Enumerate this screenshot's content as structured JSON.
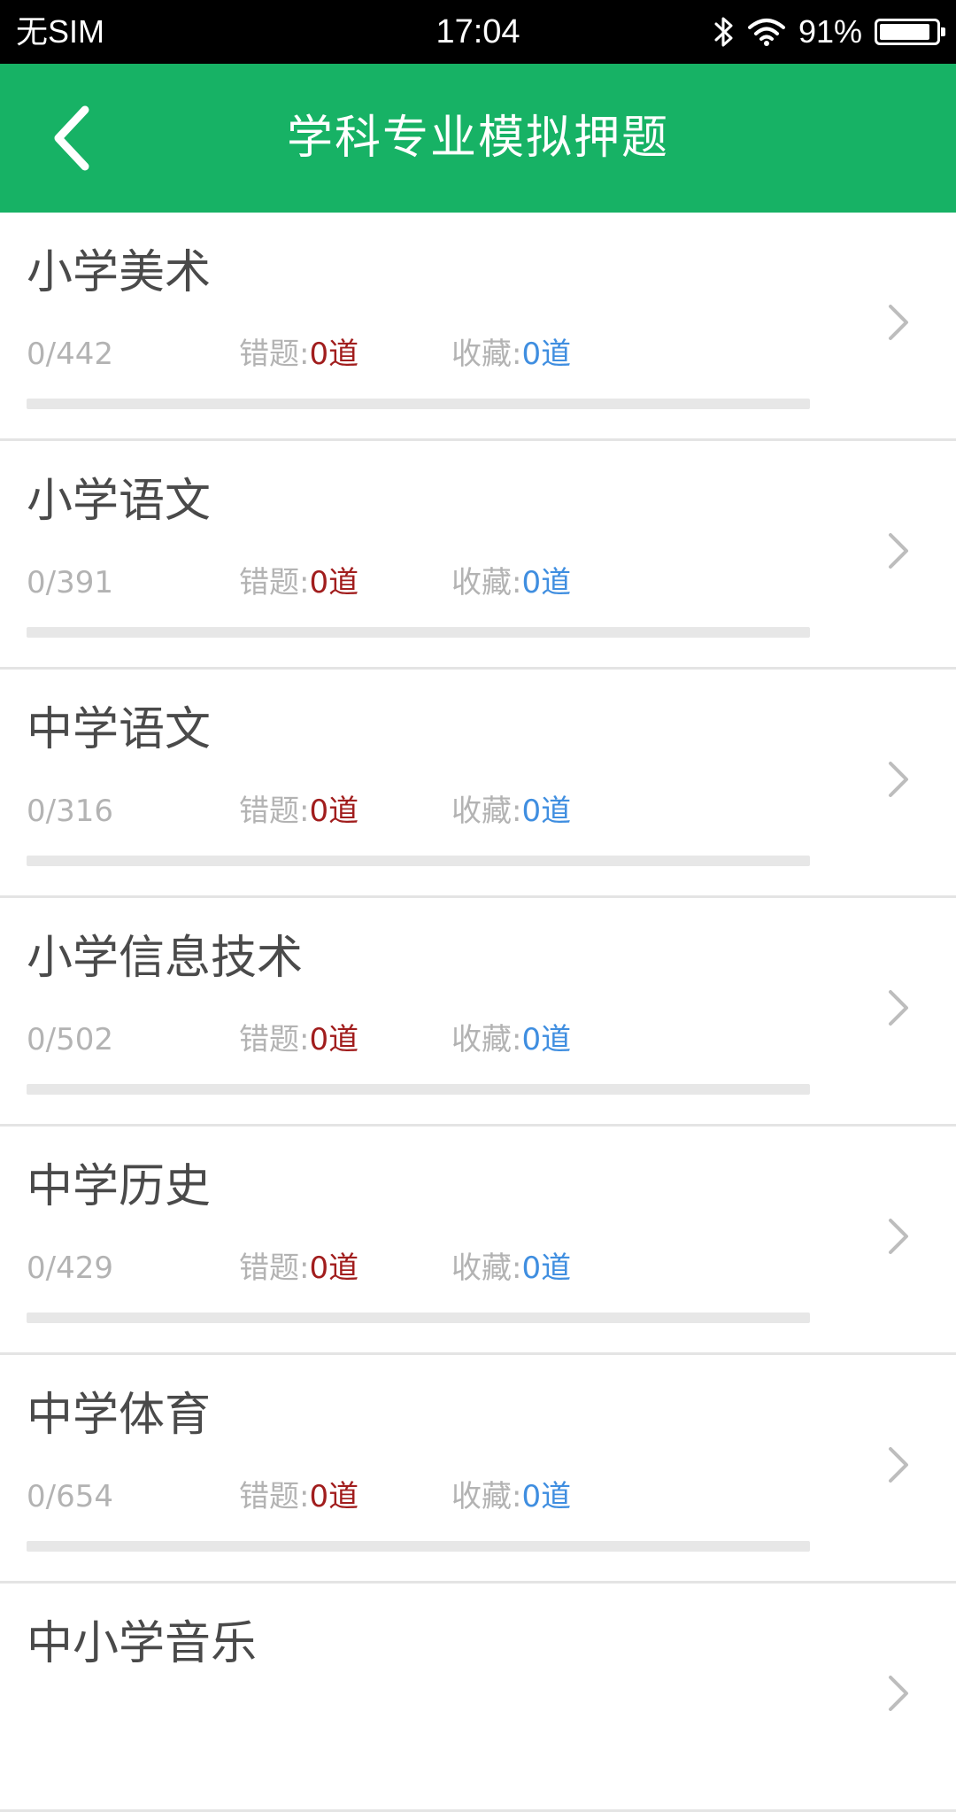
{
  "status_bar": {
    "carrier": "无SIM",
    "time": "17:04",
    "battery_text": "91%",
    "battery_level": 0.91,
    "icons": [
      "bluetooth-icon",
      "wifi-icon",
      "battery-icon"
    ]
  },
  "nav": {
    "title": "学科专业模拟押题",
    "back_icon": "chevron-left-icon",
    "background": "#17b265"
  },
  "colors": {
    "accent": "#17b265",
    "wrong_value": "#a11d1d",
    "favorite_value": "#3f8ee0"
  },
  "items": [
    {
      "title": "小学美术",
      "progress": "0/442",
      "done": 0,
      "total": 442,
      "wrong_label": "错题:",
      "wrong_value": "0道",
      "fav_label": "收藏:",
      "fav_value": "0道"
    },
    {
      "title": "小学语文",
      "progress": "0/391",
      "done": 0,
      "total": 391,
      "wrong_label": "错题:",
      "wrong_value": "0道",
      "fav_label": "收藏:",
      "fav_value": "0道"
    },
    {
      "title": "中学语文",
      "progress": "0/316",
      "done": 0,
      "total": 316,
      "wrong_label": "错题:",
      "wrong_value": "0道",
      "fav_label": "收藏:",
      "fav_value": "0道"
    },
    {
      "title": "小学信息技术",
      "progress": "0/502",
      "done": 0,
      "total": 502,
      "wrong_label": "错题:",
      "wrong_value": "0道",
      "fav_label": "收藏:",
      "fav_value": "0道"
    },
    {
      "title": "中学历史",
      "progress": "0/429",
      "done": 0,
      "total": 429,
      "wrong_label": "错题:",
      "wrong_value": "0道",
      "fav_label": "收藏:",
      "fav_value": "0道"
    },
    {
      "title": "中学体育",
      "progress": "0/654",
      "done": 0,
      "total": 654,
      "wrong_label": "错题:",
      "wrong_value": "0道",
      "fav_label": "收藏:",
      "fav_value": "0道"
    },
    {
      "title": "中小学音乐"
    }
  ]
}
